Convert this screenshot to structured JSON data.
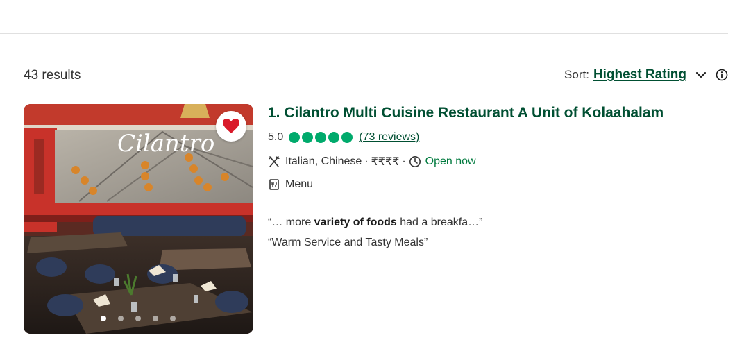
{
  "results": {
    "count_text": "43 results"
  },
  "sort": {
    "label": "Sort:",
    "value": "Highest Rating"
  },
  "listing": {
    "title": "1. Cilantro Multi Cuisine Restaurant A Unit of Kolaahalam",
    "rating": "5.0",
    "bubbles": 5,
    "reviews": "(73 reviews)",
    "cuisines": "Italian, Chinese",
    "price": "₹₹₹₹",
    "dot": "·",
    "status": "Open now",
    "menu_label": "Menu",
    "quote1": {
      "prefix": "“… more ",
      "bold": "variety of foods",
      "suffix": " had a breakfa…”"
    },
    "quote2": "“Warm Service and Tasty Meals”",
    "image_sign": "Cilantro",
    "photo_count": 5,
    "photo_index": 1
  },
  "colors": {
    "brand_green": "#004f32",
    "bubble_green": "#00aa6c",
    "open_green": "#007a3e",
    "heart_red": "#d91a2a"
  },
  "icons": [
    "chevron-down-icon",
    "info-icon",
    "heart-icon",
    "utensils-icon",
    "clock-icon",
    "menu-icon"
  ]
}
